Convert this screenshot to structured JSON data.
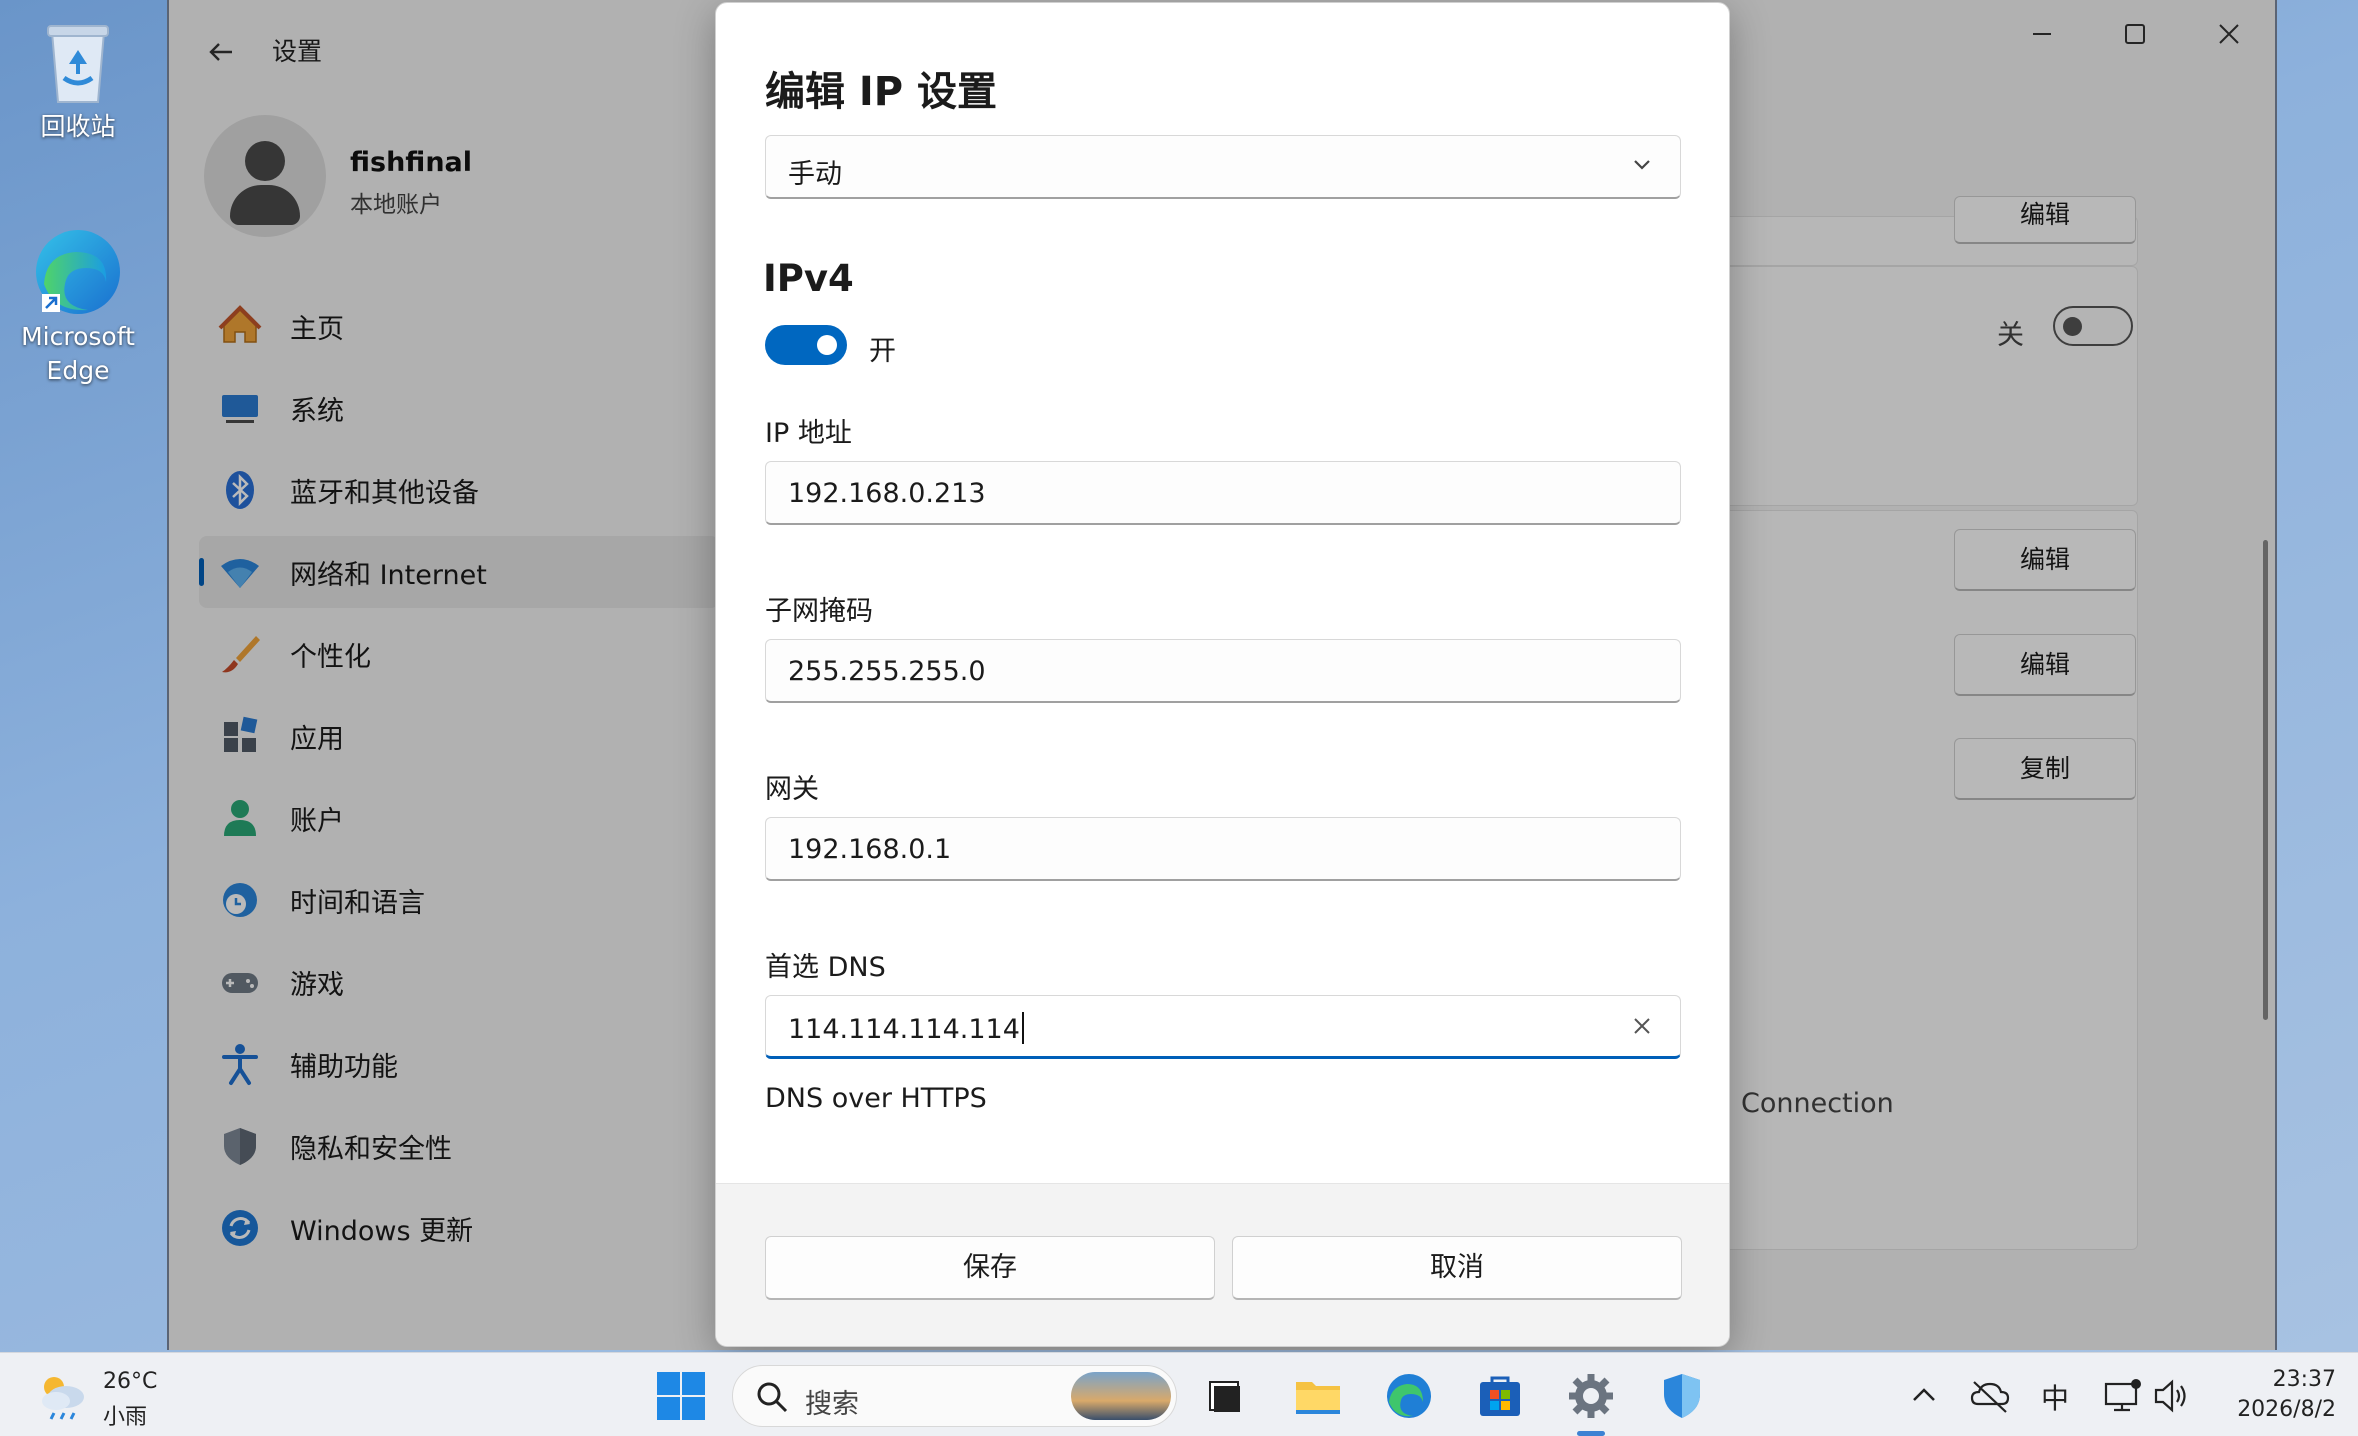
{
  "desktop": {
    "icons": [
      {
        "label": "回收站",
        "icon": "recycle-bin-icon"
      },
      {
        "label": "Microsoft Edge",
        "icon": "edge-icon"
      }
    ]
  },
  "settings": {
    "title": "设置",
    "user": {
      "name": "fishfinal",
      "account_type": "本地账户"
    },
    "nav": [
      {
        "label": "主页",
        "icon": "home-icon"
      },
      {
        "label": "系统",
        "icon": "system-icon"
      },
      {
        "label": "蓝牙和其他设备",
        "icon": "bluetooth-icon"
      },
      {
        "label": "网络和 Internet",
        "icon": "wifi-icon",
        "active": true
      },
      {
        "label": "个性化",
        "icon": "brush-icon"
      },
      {
        "label": "应用",
        "icon": "apps-icon"
      },
      {
        "label": "账户",
        "icon": "account-icon"
      },
      {
        "label": "时间和语言",
        "icon": "time-language-icon"
      },
      {
        "label": "游戏",
        "icon": "gamepad-icon"
      },
      {
        "label": "辅助功能",
        "icon": "accessibility-icon"
      },
      {
        "label": "隐私和安全性",
        "icon": "shield-icon"
      },
      {
        "label": "Windows 更新",
        "icon": "windows-update-icon"
      }
    ],
    "right_pane": {
      "toggle_label": "关",
      "buttons": [
        "编辑",
        "编辑",
        "复制"
      ],
      "partial_text": "Connection",
      "top_button_partial": "编辑"
    }
  },
  "dialog": {
    "title": "编辑 IP 设置",
    "mode_select": {
      "value": "手动"
    },
    "section": "IPv4",
    "ipv4_toggle": {
      "state": "on",
      "label": "开"
    },
    "fields": {
      "ip_address": {
        "label": "IP 地址",
        "value": "192.168.0.213"
      },
      "subnet_mask": {
        "label": "子网掩码",
        "value": "255.255.255.0"
      },
      "gateway": {
        "label": "网关",
        "value": "192.168.0.1"
      },
      "preferred_dns": {
        "label": "首选 DNS",
        "value": "114.114.114.114"
      }
    },
    "dns_over_https_label": "DNS over HTTPS",
    "save_label": "保存",
    "cancel_label": "取消"
  },
  "taskbar": {
    "weather": {
      "temp": "26°C",
      "desc": "小雨"
    },
    "search_placeholder": "搜索",
    "ime": "中",
    "time": "23:37",
    "date": "2026/8/2"
  },
  "colors": {
    "accent": "#0067c0",
    "focus_underline": "#005fb8"
  }
}
